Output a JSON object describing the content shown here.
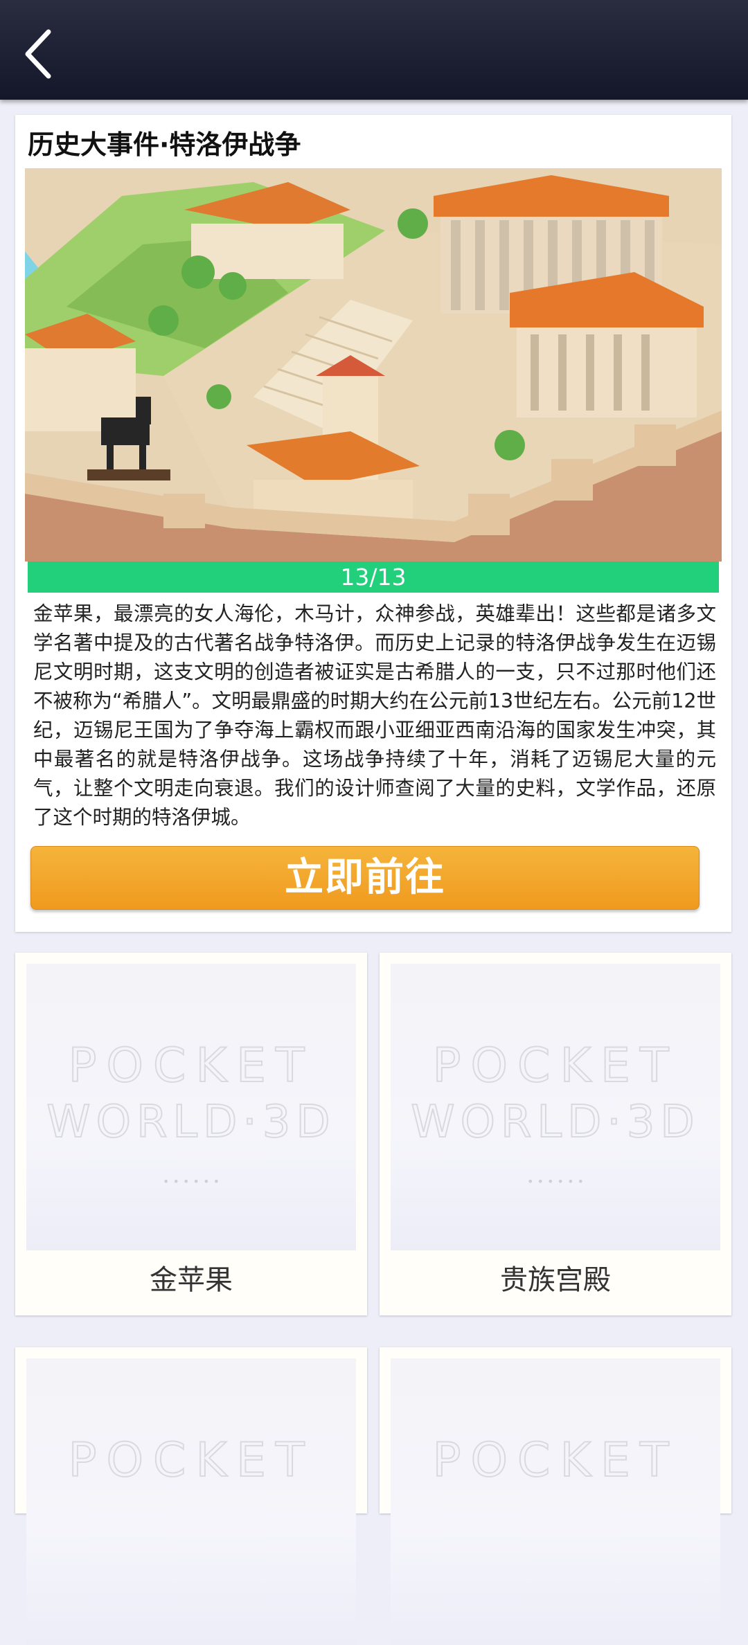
{
  "header": {
    "back_icon": "back-arrow-icon"
  },
  "event": {
    "title": "历史大事件·特洛伊战争",
    "progress": "13/13",
    "description": "金苹果，最漂亮的女人海伦，木马计，众神参战，英雄辈出！这些都是诸多文学名著中提及的古代著名战争特洛伊。而历史上记录的特洛伊战争发生在迈锡尼文明时期，这支文明的创造者被证实是古希腊人的一支，只不过那时他们还不被称为“希腊人”。文明最鼎盛的时期大约在公元前13世纪左右。公元前12世纪，迈锡尼王国为了争夺海上霸权而跟小亚细亚西南沿海的国家发生冲突，其中最著名的就是特洛伊战争。这场战争持续了十年，消耗了迈锡尼大量的元气，让整个文明走向衰退。我们的设计师查阅了大量的史料，文学作品，还原了这个时期的特洛伊城。",
    "go_button": "立即前往",
    "accent_color": "#22cf7a",
    "button_color": "#f5a72c"
  },
  "placeholder": {
    "line1": "POCKET",
    "line2": "WORLD·3D",
    "dots": "• • • • • •"
  },
  "items": [
    {
      "label": "金苹果"
    },
    {
      "label": "贵族宫殿"
    },
    {
      "label": ""
    },
    {
      "label": ""
    }
  ]
}
